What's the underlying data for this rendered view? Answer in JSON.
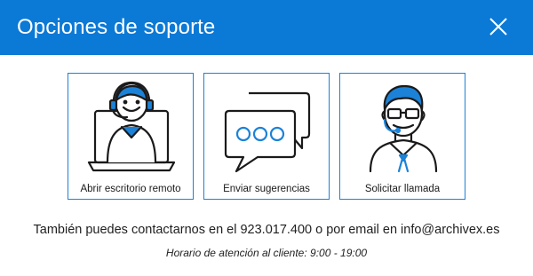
{
  "dialog": {
    "title": "Opciones de soporte",
    "close_icon": "close-icon"
  },
  "options": [
    {
      "label": "Abrir escritorio remoto",
      "icon": "remote-desktop-agent-icon"
    },
    {
      "label": "Enviar sugerencias",
      "icon": "chat-bubbles-icon"
    },
    {
      "label": "Solicitar llamada",
      "icon": "call-agent-headset-icon"
    }
  ],
  "contact_text": "También puedes contactarnos en el 923.017.400 o por email en info@archivex.es",
  "hours_text": "Horario de atención al cliente: 9:00 - 19:00",
  "colors": {
    "titlebar": "#0b79d6",
    "accent": "#1b82d8",
    "text": "#1f1f1f"
  }
}
